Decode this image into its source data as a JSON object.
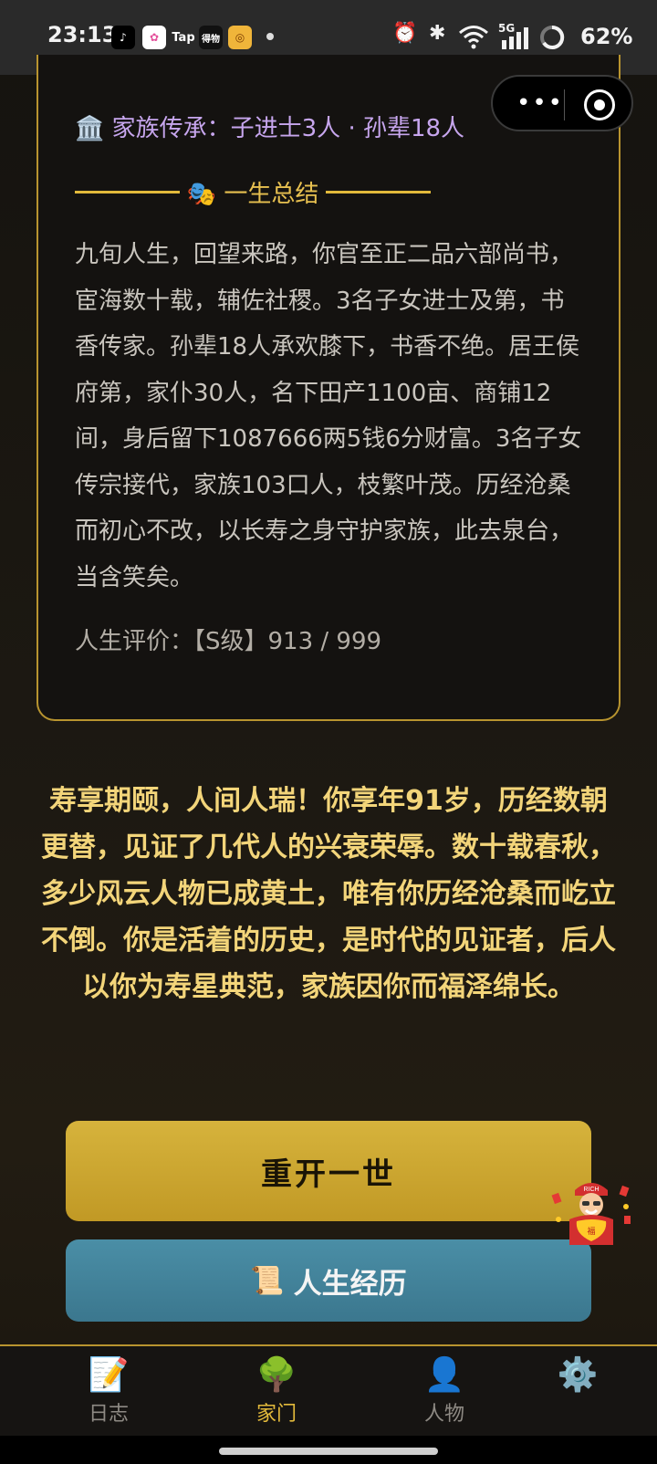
{
  "status_bar": {
    "time": "23:13",
    "apps": [
      "tiktok-icon",
      "photos-icon",
      "tap-icon",
      "dewu-icon",
      "game-icon"
    ],
    "tap_label": "Tap",
    "dewu_label": "得物",
    "network": "5G",
    "battery": "62%"
  },
  "capsule": {
    "more_label": "•••"
  },
  "card": {
    "family_icon": "🏛️",
    "family_line": "家族传承：子进士3人 · 孙辈18人",
    "divider_icon": "🎭",
    "divider_title": "一生总结",
    "summary": "九旬人生，回望来路，你官至正二品六部尚书，宦海数十载，辅佐社稷。3名子女进士及第，书香传家。孙辈18人承欢膝下，书香不绝。居王侯府第，家仆30人，名下田产1100亩、商铺12间，身后留下1087666两5钱6分财富。3名子女传宗接代，家族103口人，枝繁叶茂。历经沧桑而初心不改，以长寿之身守护家族，此去泉台，当含笑矣。",
    "rating": "人生评价：【S级】913 / 999"
  },
  "epitaph": "寿享期颐，人间人瑞！你享年91岁，历经数朝更替，见证了几代人的兴衰荣辱。数十载春秋，多少风云人物已成黄土，唯有你历经沧桑而屹立不倒。你是活着的历史，是时代的见证者，后人以你为寿星典范，家族因你而福泽绵长。",
  "buttons": {
    "restart": "重开一世",
    "history_icon": "📜",
    "history": "人生经历"
  },
  "mascot": {
    "badge": "RICH",
    "chest": "福"
  },
  "nav": {
    "items": [
      {
        "icon": "📝",
        "label": "日志"
      },
      {
        "icon": "🌳",
        "label": "家门"
      },
      {
        "icon": "👤",
        "label": "人物"
      },
      {
        "icon": "⚙️",
        "label": ""
      }
    ],
    "active_index": 1
  },
  "colors": {
    "accent_gold": "#e2b93b",
    "family_purple": "#c7a6ee",
    "epitaph_gold": "#f3d57a",
    "restart_button": "#cfa831",
    "history_button": "#4384a0"
  }
}
